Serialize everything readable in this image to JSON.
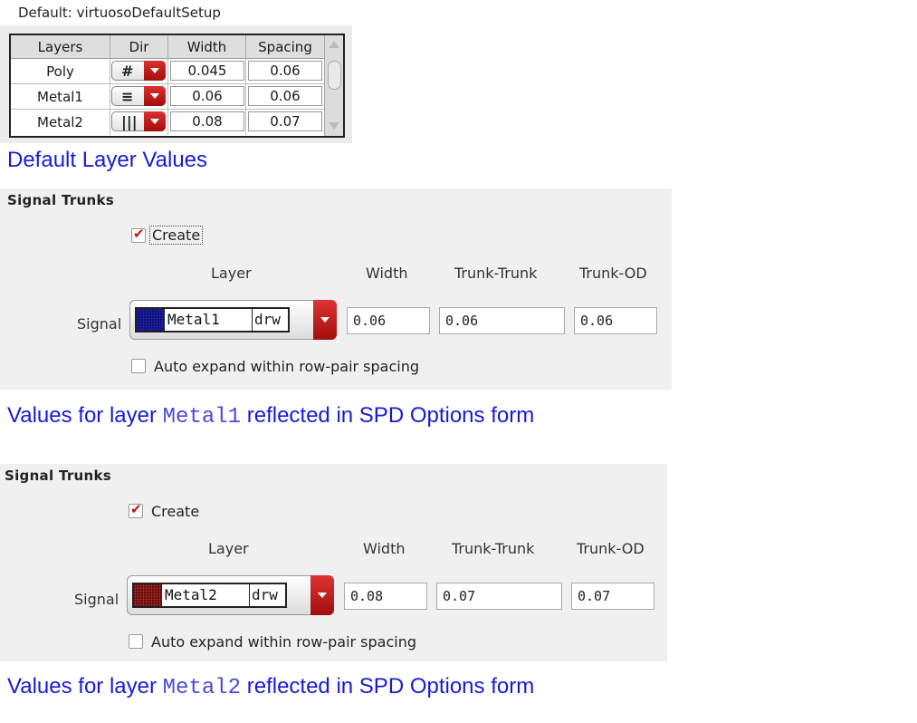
{
  "setup": {
    "label": "Default: virtuosoDefaultSetup"
  },
  "table": {
    "headers": [
      "Layers",
      "Dir",
      "Width",
      "Spacing"
    ],
    "rows": [
      {
        "layer": "Poly",
        "dir_glyph": "#",
        "dir_icon": "grid-direction-icon",
        "width": "0.045",
        "spacing": "0.06"
      },
      {
        "layer": "Metal1",
        "dir_glyph": "≡",
        "dir_icon": "horizontal-direction-icon",
        "width": "0.06",
        "spacing": "0.06"
      },
      {
        "layer": "Metal2",
        "dir_glyph": "|||",
        "dir_icon": "vertical-direction-icon",
        "width": "0.08",
        "spacing": "0.07"
      }
    ]
  },
  "captions": {
    "defaults": "Default Layer Values",
    "metal1": {
      "prefix": "Values for layer ",
      "code": "Metal1",
      "suffix": " reflected in SPD Options form"
    },
    "metal2": {
      "prefix": "Values for layer ",
      "code": "Metal2",
      "suffix": " reflected in SPD Options form"
    }
  },
  "spd1": {
    "title": "Signal Trunks",
    "create_label": "Create",
    "create_checked": true,
    "headers": {
      "layer": "Layer",
      "width": "Width",
      "trunk_trunk": "Trunk-Trunk",
      "trunk_od": "Trunk-OD"
    },
    "row_label": "Signal",
    "layer": "Metal1",
    "purpose": "drw",
    "swatch_color": "#0a0a5e",
    "width": "0.06",
    "trunk_trunk": "0.06",
    "trunk_od": "0.06",
    "auto_expand_label": "Auto expand within row-pair spacing",
    "auto_expand_checked": false
  },
  "spd2": {
    "title": "Signal Trunks",
    "create_label": "Create",
    "create_checked": true,
    "headers": {
      "layer": "Layer",
      "width": "Width",
      "trunk_trunk": "Trunk-Trunk",
      "trunk_od": "Trunk-OD"
    },
    "row_label": "Signal",
    "layer": "Metal2",
    "purpose": "drw",
    "swatch_color": "#4a0a0a",
    "width": "0.08",
    "trunk_trunk": "0.07",
    "trunk_od": "0.07",
    "auto_expand_label": "Auto expand within row-pair spacing",
    "auto_expand_checked": false
  },
  "colors": {
    "caption": "#1a1ad6",
    "accent_red": "#c41a1a",
    "panel": "#f0f0f0"
  }
}
